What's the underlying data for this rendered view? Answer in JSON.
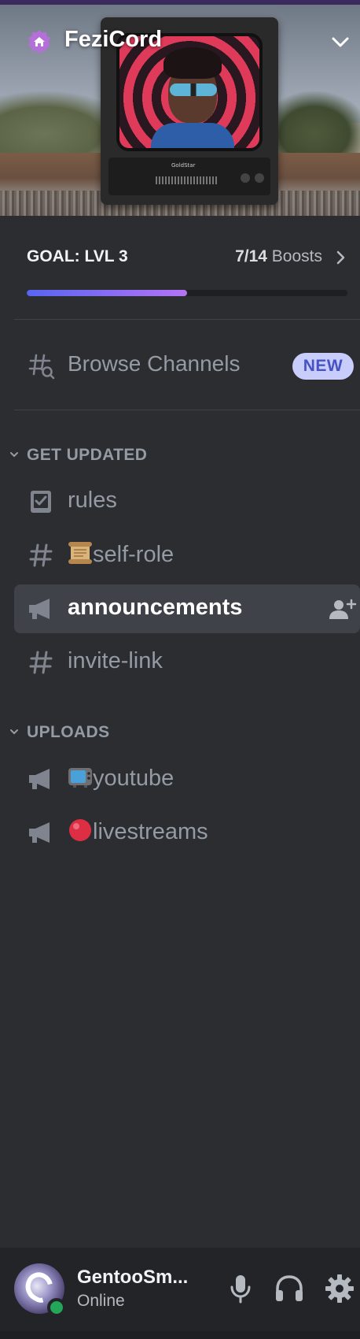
{
  "server": {
    "name": "FeziCord",
    "banner_brand": "GoldStar"
  },
  "boost_goal": {
    "label": "GOAL: LVL 3",
    "current": "7/14",
    "suffix": "Boosts",
    "progress_fraction": 0.5
  },
  "browse": {
    "label": "Browse Channels",
    "badge": "NEW"
  },
  "categories": [
    {
      "label": "GET UPDATED",
      "channels": [
        {
          "name": "rules",
          "icon": "rules-icon"
        },
        {
          "name": "self-role",
          "icon": "hashtag-icon",
          "emoji": "scroll-emoji"
        },
        {
          "name": "announcements",
          "icon": "megaphone-icon",
          "selected": true
        },
        {
          "name": "invite-link",
          "icon": "hashtag-icon"
        }
      ]
    },
    {
      "label": "UPLOADS",
      "channels": [
        {
          "name": "youtube",
          "icon": "megaphone-icon",
          "emoji": "television-emoji"
        },
        {
          "name": "livestreams",
          "icon": "megaphone-icon",
          "emoji": "red-circle-emoji"
        }
      ]
    }
  ],
  "user": {
    "name": "GentooSm...",
    "status": "Online"
  },
  "colors": {
    "background": "#2b2d31",
    "user_panel": "#232428",
    "selected_channel": "#404249",
    "muted_text": "#949ba4",
    "new_badge_bg": "#c9cdfb",
    "new_badge_text": "#4752c4",
    "online": "#23a55a",
    "progress_start": "#5865f2",
    "progress_end": "#b473f5"
  }
}
